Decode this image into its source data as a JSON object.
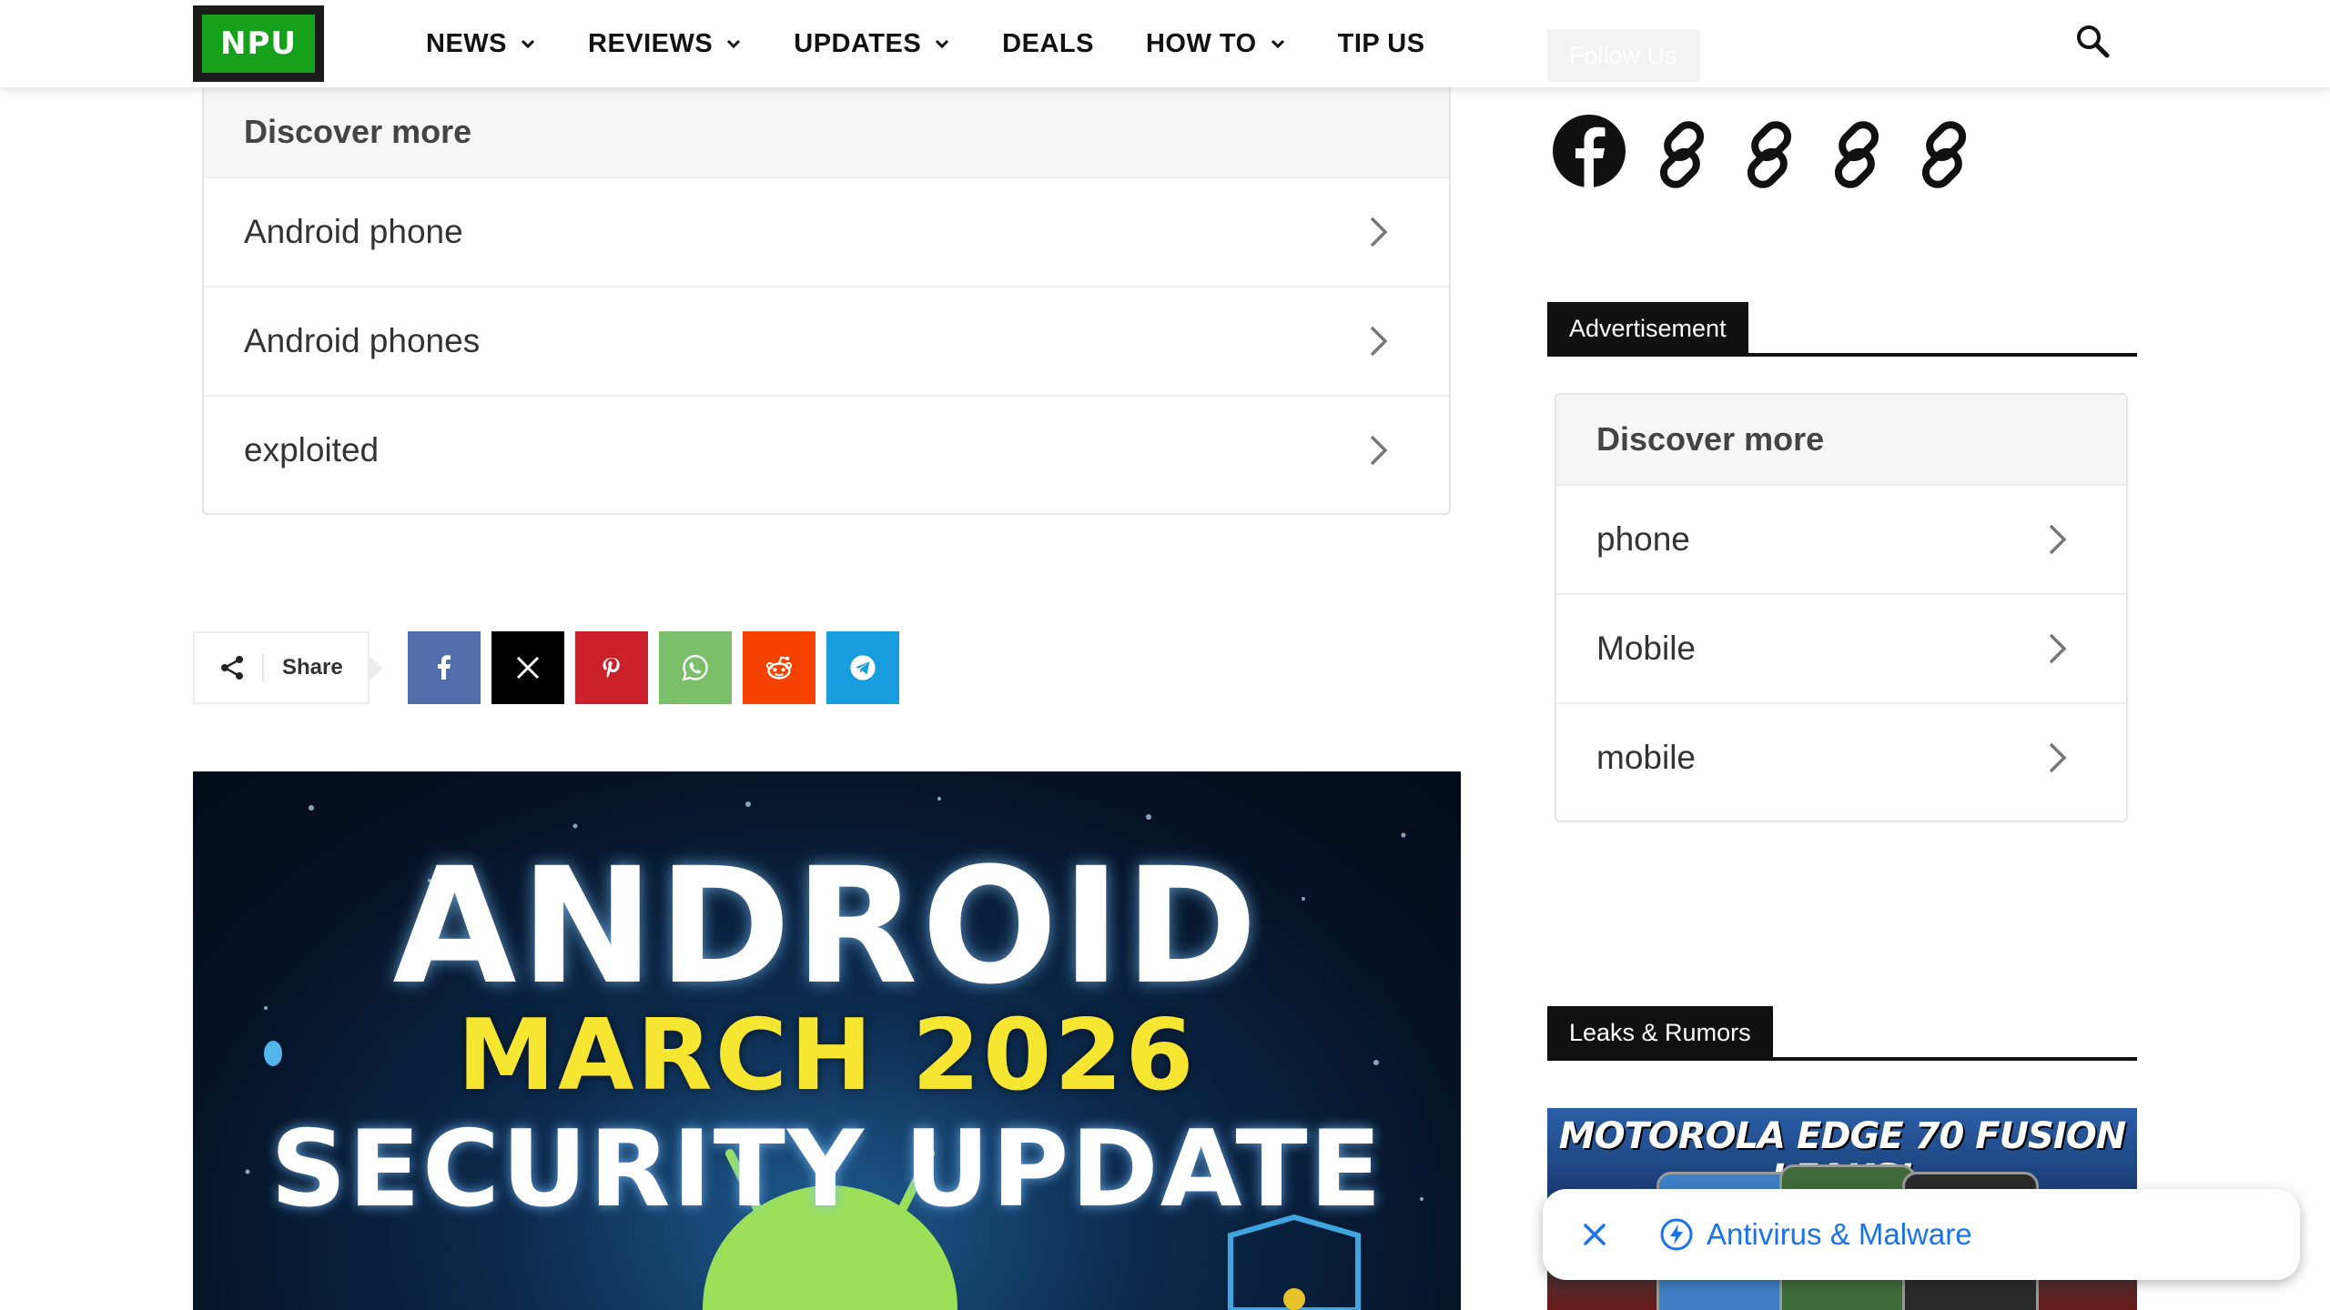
{
  "header": {
    "logo_text": "NPU",
    "nav": [
      {
        "label": "NEWS",
        "has_dropdown": true
      },
      {
        "label": "REVIEWS",
        "has_dropdown": true
      },
      {
        "label": "UPDATES",
        "has_dropdown": true
      },
      {
        "label": "DEALS",
        "has_dropdown": false
      },
      {
        "label": "HOW TO",
        "has_dropdown": true
      },
      {
        "label": "TIP US",
        "has_dropdown": false
      }
    ],
    "follow_label": "Follow Us"
  },
  "discover_main": {
    "title": "Discover more",
    "items": [
      "Android phone",
      "Android phones",
      "exploited"
    ]
  },
  "share": {
    "label": "Share",
    "buttons": [
      {
        "name": "facebook",
        "color": "#516eab"
      },
      {
        "name": "x",
        "color": "#000000"
      },
      {
        "name": "pinterest",
        "color": "#ca212a"
      },
      {
        "name": "whatsapp",
        "color": "#7bbf6a"
      },
      {
        "name": "reddit",
        "color": "#f54200"
      },
      {
        "name": "telegram",
        "color": "#179cde"
      }
    ]
  },
  "hero": {
    "line1": "ANDROID",
    "line2": "MARCH 2026",
    "line3": "SECURITY UPDATE"
  },
  "sidebar": {
    "social_icons": [
      "facebook-icon",
      "link-icon",
      "link-icon",
      "link-icon",
      "link-icon"
    ],
    "advertisement_label": "Advertisement",
    "discover": {
      "title": "Discover more",
      "items": [
        "phone",
        "Mobile",
        "mobile"
      ]
    },
    "leaks_label": "Leaks & Rumors",
    "leaks_image_title": "MOTOROLA EDGE 70 FUSION LEAKS!"
  },
  "popup": {
    "link_text": "Antivirus & Malware"
  },
  "colors": {
    "logo_green": "#16a11a",
    "link_blue": "#1a73e8"
  }
}
